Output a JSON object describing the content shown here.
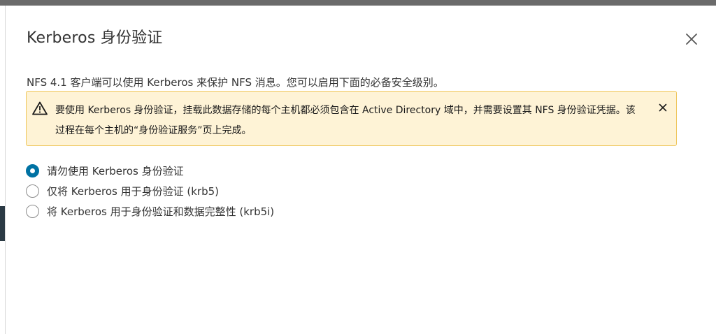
{
  "dialog": {
    "title": "Kerberos 身份验证",
    "description": "NFS 4.1 客户端可以使用 Kerberos 来保护 NFS 消息。您可以启用下面的必备安全级别。",
    "close_icon": "close-icon"
  },
  "alert": {
    "type": "warning",
    "icon": "warning-triangle-icon",
    "text": "要使用 Kerberos 身份验证，挂载此数据存储的每个主机都必须包含在 Active Directory 域中，并需要设置其 NFS 身份验证凭据。该过程在每个主机的“身份验证服务”页上完成。",
    "close_icon": "close-icon",
    "background_color": "#fef3d6",
    "border_color": "#efc75e"
  },
  "kerberos_options": {
    "selected_index": 0,
    "accent_color": "#0072a3",
    "options": [
      {
        "label": "请勿使用 Kerberos 身份验证",
        "checked": true
      },
      {
        "label": "仅将 Kerberos 用于身份验证 (krb5)",
        "checked": false
      },
      {
        "label": "将 Kerberos 用于身份验证和数据完整性 (krb5i)",
        "checked": false
      }
    ]
  }
}
